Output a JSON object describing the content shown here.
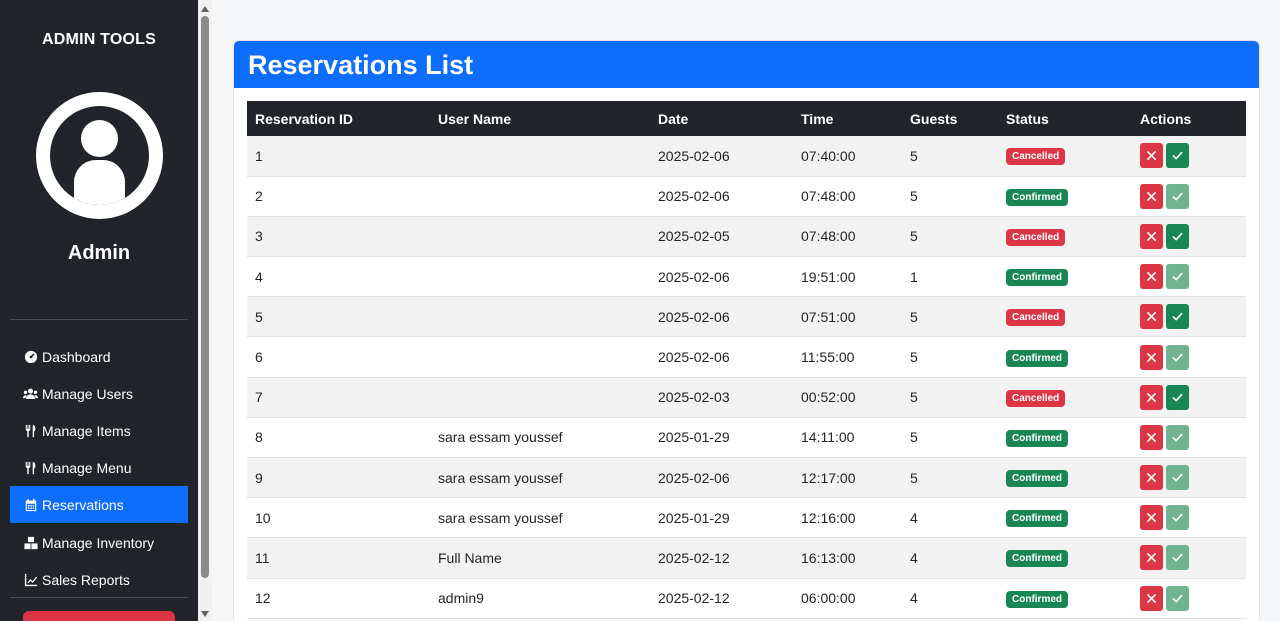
{
  "sidebar": {
    "title": "ADMIN TOOLS",
    "user_name": "Admin",
    "items": [
      {
        "label": "Dashboard",
        "icon": "tachometer-icon",
        "active": false
      },
      {
        "label": "Manage Users",
        "icon": "users-icon",
        "active": false
      },
      {
        "label": "Manage Items",
        "icon": "utensils-icon",
        "active": false
      },
      {
        "label": "Manage Menu",
        "icon": "utensils-icon",
        "active": false
      },
      {
        "label": "Reservations",
        "icon": "calendar-icon",
        "active": true
      },
      {
        "label": "Manage Inventory",
        "icon": "boxes-icon",
        "active": false
      },
      {
        "label": "Sales Reports",
        "icon": "chart-line-icon",
        "active": false
      }
    ]
  },
  "main": {
    "title": "Reservations List",
    "columns": [
      "Reservation ID",
      "User Name",
      "Date",
      "Time",
      "Guests",
      "Status",
      "Actions"
    ],
    "rows": [
      {
        "id": "1",
        "user": "",
        "date": "2025-02-06",
        "time": "07:40:00",
        "guests": "5",
        "status": "Cancelled"
      },
      {
        "id": "2",
        "user": "",
        "date": "2025-02-06",
        "time": "07:48:00",
        "guests": "5",
        "status": "Confirmed"
      },
      {
        "id": "3",
        "user": "",
        "date": "2025-02-05",
        "time": "07:48:00",
        "guests": "5",
        "status": "Cancelled"
      },
      {
        "id": "4",
        "user": "",
        "date": "2025-02-06",
        "time": "19:51:00",
        "guests": "1",
        "status": "Confirmed"
      },
      {
        "id": "5",
        "user": "",
        "date": "2025-02-06",
        "time": "07:51:00",
        "guests": "5",
        "status": "Cancelled"
      },
      {
        "id": "6",
        "user": "",
        "date": "2025-02-06",
        "time": "11:55:00",
        "guests": "5",
        "status": "Confirmed"
      },
      {
        "id": "7",
        "user": "",
        "date": "2025-02-03",
        "time": "00:52:00",
        "guests": "5",
        "status": "Cancelled"
      },
      {
        "id": "8",
        "user": "sara essam youssef",
        "date": "2025-01-29",
        "time": "14:11:00",
        "guests": "5",
        "status": "Confirmed"
      },
      {
        "id": "9",
        "user": "sara essam youssef",
        "date": "2025-02-06",
        "time": "12:17:00",
        "guests": "5",
        "status": "Confirmed"
      },
      {
        "id": "10",
        "user": "sara essam youssef",
        "date": "2025-01-29",
        "time": "12:16:00",
        "guests": "4",
        "status": "Confirmed"
      },
      {
        "id": "11",
        "user": "Full Name",
        "date": "2025-02-12",
        "time": "16:13:00",
        "guests": "4",
        "status": "Confirmed"
      },
      {
        "id": "12",
        "user": "admin9",
        "date": "2025-02-12",
        "time": "06:00:00",
        "guests": "4",
        "status": "Confirmed"
      }
    ]
  },
  "colors": {
    "sidebar_bg": "#212529",
    "accent": "#0d6efd",
    "cancelled": "#dc3545",
    "confirmed": "#198754"
  }
}
